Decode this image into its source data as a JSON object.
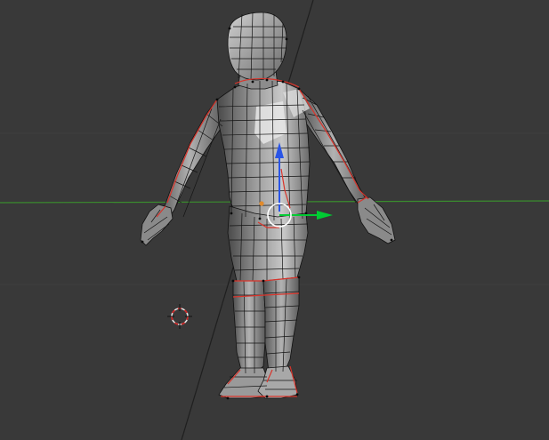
{
  "viewport": {
    "mode": "edit-mode-wireframe-overlay",
    "background": "#393939"
  },
  "scene": {
    "object": "humanoid-mesh",
    "selected_edge_color": "#d9342b",
    "vertex_color": "#0a0a0a",
    "mesh_fill_light": "#bdbdbd",
    "mesh_fill_mid": "#8e8e8e",
    "mesh_fill_dark": "#5e5e5e"
  },
  "gizmo": {
    "x_axis_color": "#00cc33",
    "z_axis_color": "#2a55e6",
    "ring_color": "#ffffff",
    "origin_color": "#e08a2c"
  },
  "cursor_3d": {
    "icon": "3d-cursor-icon",
    "colors": [
      "#e0e0e0",
      "#d02020"
    ]
  },
  "axes": {
    "x_line_color": "#3a8c2e",
    "y_line_color": "#1f1f1f"
  }
}
